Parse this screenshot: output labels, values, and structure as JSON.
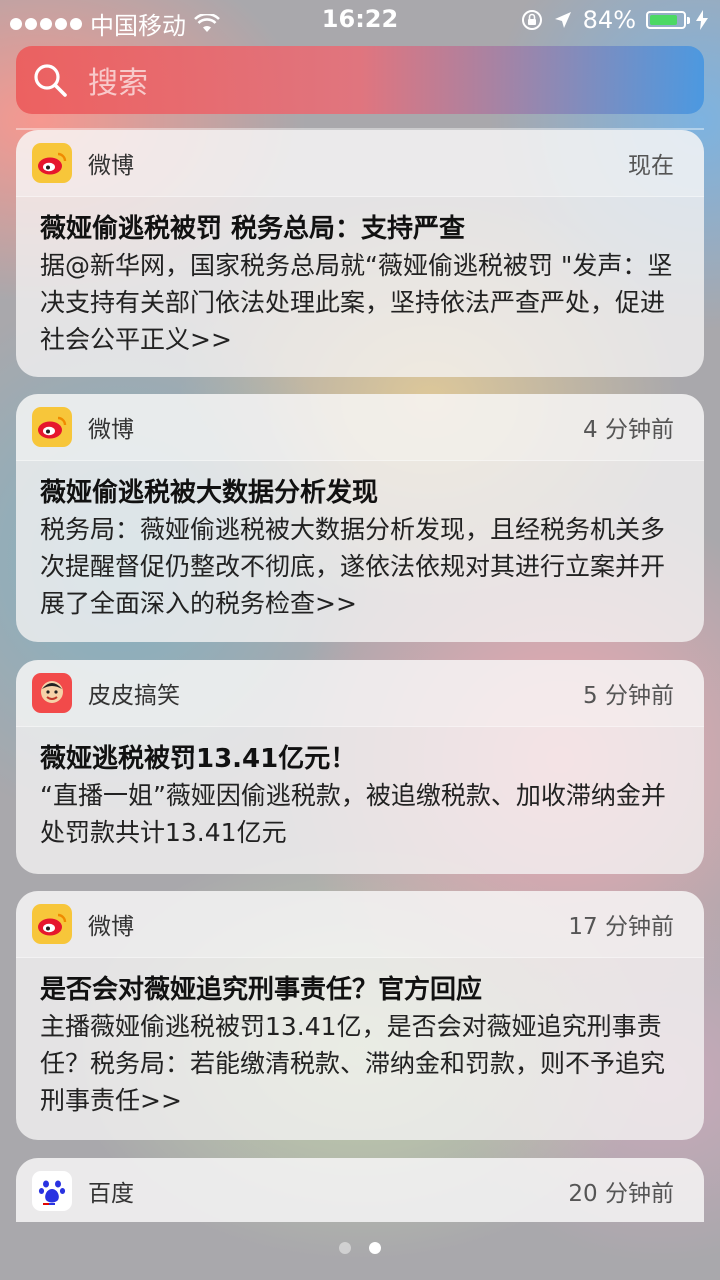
{
  "status_bar": {
    "carrier": "中国移动",
    "time": "16:22",
    "battery": "84%",
    "battery_level": 0.84
  },
  "search": {
    "placeholder": "搜索"
  },
  "notifications": [
    {
      "app": "微博",
      "time": "现在",
      "title": "薇娅偷逃税被罚 税务总局：支持严查",
      "body": "据@新华网，国家税务总局就“薇娅偷逃税被罚 \"发声：坚决支持有关部门依法处理此案，坚持依法严查严处，促进社会公平正义>>"
    },
    {
      "app": "微博",
      "time": "4 分钟前",
      "title": "薇娅偷逃税被大数据分析发现",
      "body": "税务局：薇娅偷逃税被大数据分析发现，且经税务机关多次提醒督促仍整改不彻底，遂依法依规对其进行立案并开展了全面深入的税务检查>>"
    },
    {
      "app": "皮皮搞笑",
      "time": "5 分钟前",
      "title": "薇娅逃税被罚13.41亿元！",
      "body": "“直播一姐”薇娅因偷逃税款，被追缴税款、加收滞纳金并处罚款共计13.41亿元"
    },
    {
      "app": "微博",
      "time": "17 分钟前",
      "title": "是否会对薇娅追究刑事责任？官方回应",
      "body": "主播薇娅偷逃税被罚13.41亿，是否会对薇娅追究刑事责任？税务局：若能缴清税款、滞纳金和罚款，则不予追究刑事责任>>"
    },
    {
      "app": "百度",
      "time": "20 分钟前"
    }
  ],
  "icons": {
    "weibo": "weibo-icon",
    "pipi": "pipi-gaoxiao-icon",
    "baidu": "baidu-icon"
  },
  "pager": {
    "pages": 2,
    "current": 2
  },
  "colors": {
    "battery_fill": "#4cd964",
    "weibo_bg": "#f7c63a",
    "pipi_bg": "#f24a4a",
    "baidu_blue": "#2932e1"
  }
}
